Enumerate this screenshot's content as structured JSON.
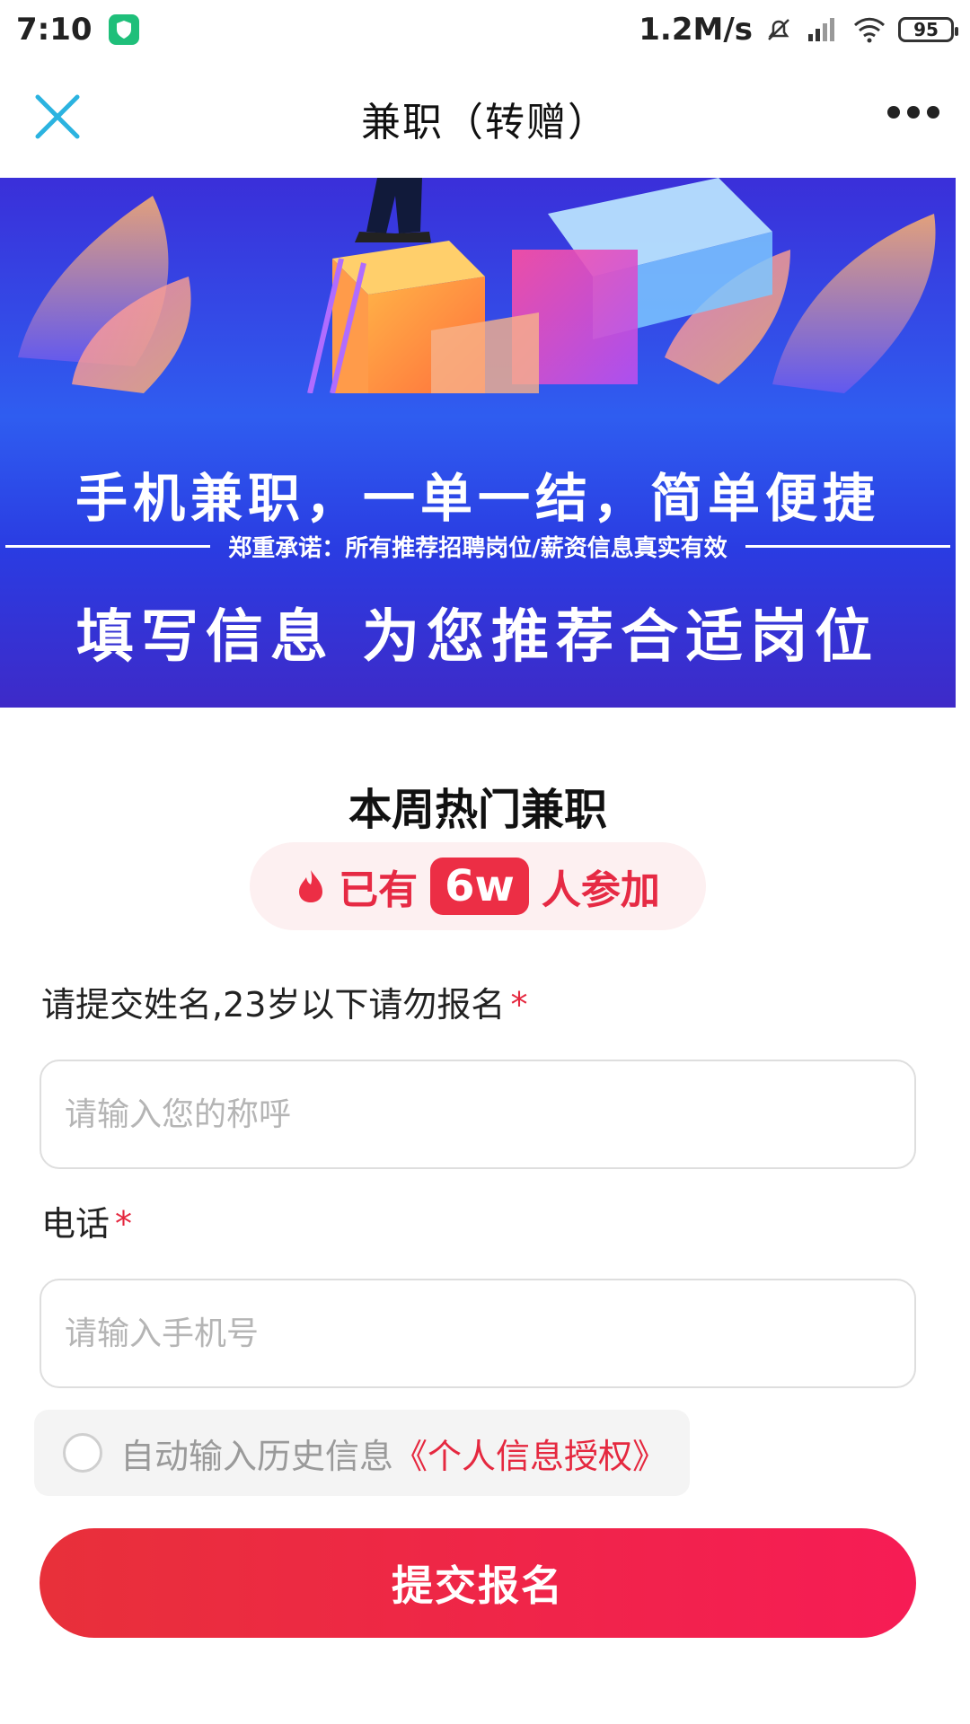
{
  "status_bar": {
    "time": "7:10",
    "network_speed": "1.2M/s",
    "battery": "95"
  },
  "header": {
    "title": "兼职（转赠）"
  },
  "banner": {
    "headline": "手机兼职，一单一结，简单便捷",
    "promise": "郑重承诺：所有推荐招聘岗位/薪资信息真实有效",
    "subheadline": "填写信息 为您推荐合适岗位"
  },
  "hot": {
    "title": "本周热门兼职",
    "prefix": "已有",
    "count": "6w",
    "suffix": "人参加"
  },
  "form": {
    "name_label": "请提交姓名,23岁以下请勿报名",
    "name_placeholder": "请输入您的称呼",
    "phone_label": "电话",
    "phone_placeholder": "请输入手机号",
    "required_mark": "*"
  },
  "auth": {
    "text": "自动输入历史信息",
    "link": "《个人信息授权》"
  },
  "submit": {
    "label": "提交报名"
  },
  "colors": {
    "accent_red": "#e5283f",
    "banner_blue": "#2f5df0",
    "close_icon": "#2bb3e0"
  }
}
